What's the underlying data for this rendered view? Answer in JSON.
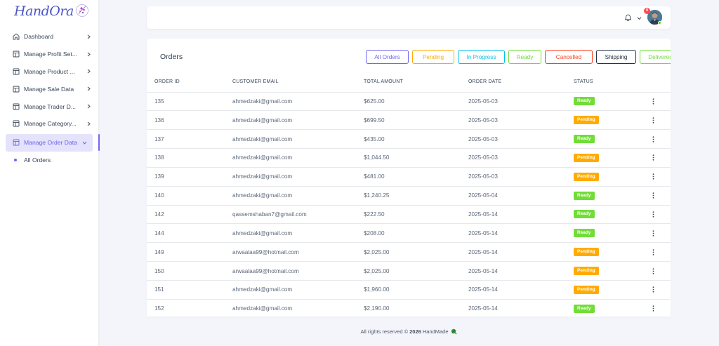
{
  "brand": {
    "name": "HandOra"
  },
  "sidebar": {
    "items": [
      {
        "label": "Dashboard",
        "icon": "home-icon"
      },
      {
        "label": "Manage Profit Set...",
        "icon": "layout-icon"
      },
      {
        "label": "Manage Product ...",
        "icon": "layout-icon"
      },
      {
        "label": "Manage Sale Data",
        "icon": "layout-icon"
      },
      {
        "label": "Manage Trader D...",
        "icon": "layout-icon"
      },
      {
        "label": "Manage Category...",
        "icon": "layout-icon"
      },
      {
        "label": "Manage Order Data",
        "icon": "layout-icon",
        "active": true
      }
    ],
    "subitems": [
      {
        "label": "All Orders"
      }
    ]
  },
  "topbar": {
    "notification_count": "0"
  },
  "orders": {
    "title": "Orders",
    "filters": [
      {
        "label": "All Orders",
        "color": "#7367f0"
      },
      {
        "label": "Pending",
        "color": "#ffab00"
      },
      {
        "label": "In Progress",
        "color": "#03c3ec"
      },
      {
        "label": "Ready",
        "color": "#71dd37"
      },
      {
        "label": "Cancelled",
        "color": "#ff3e1d"
      },
      {
        "label": "Shipping",
        "color": "#233446"
      },
      {
        "label": "Delivered",
        "color": "#71dd37"
      }
    ],
    "columns": [
      "ORDER ID",
      "CUSTOMER EMAIL",
      "TOTAL AMOUNT",
      "ORDER DATE",
      "STATUS"
    ],
    "status_colors": {
      "Ready": "#71dd37",
      "Pending": "#ffab00"
    },
    "rows": [
      {
        "id": "135",
        "email": "ahmedzaki@gmail.com",
        "amount": "$625.00",
        "date": "2025-05-03",
        "status": "Ready"
      },
      {
        "id": "136",
        "email": "ahmedzaki@gmail.com",
        "amount": "$699.50",
        "date": "2025-05-03",
        "status": "Pending"
      },
      {
        "id": "137",
        "email": "ahmedzaki@gmail.com",
        "amount": "$435.00",
        "date": "2025-05-03",
        "status": "Ready"
      },
      {
        "id": "138",
        "email": "ahmedzaki@gmail.com",
        "amount": "$1,044.50",
        "date": "2025-05-03",
        "status": "Pending"
      },
      {
        "id": "139",
        "email": "ahmedzaki@gmail.com",
        "amount": "$481.00",
        "date": "2025-05-03",
        "status": "Pending"
      },
      {
        "id": "140",
        "email": "ahmedzaki@gmail.com",
        "amount": "$1,240.25",
        "date": "2025-05-04",
        "status": "Ready"
      },
      {
        "id": "142",
        "email": "qassemshaban7@gmail.com",
        "amount": "$222.50",
        "date": "2025-05-14",
        "status": "Ready"
      },
      {
        "id": "144",
        "email": "ahmedzaki@gmail.com",
        "amount": "$208.00",
        "date": "2025-05-14",
        "status": "Ready"
      },
      {
        "id": "149",
        "email": "arwaalaa99@hotmail.com",
        "amount": "$2,025.00",
        "date": "2025-05-14",
        "status": "Pending"
      },
      {
        "id": "150",
        "email": "arwaalaa99@hotmail.com",
        "amount": "$2,025.00",
        "date": "2025-05-14",
        "status": "Pending"
      },
      {
        "id": "151",
        "email": "ahmedzaki@gmail.com",
        "amount": "$1,960.00",
        "date": "2025-05-14",
        "status": "Pending"
      },
      {
        "id": "152",
        "email": "ahmedzaki@gmail.com",
        "amount": "$2,190.00",
        "date": "2025-05-14",
        "status": "Ready"
      }
    ]
  },
  "footer": {
    "prefix": "All rights reserved ©",
    "year": "2026",
    "brand": "HandMade"
  }
}
